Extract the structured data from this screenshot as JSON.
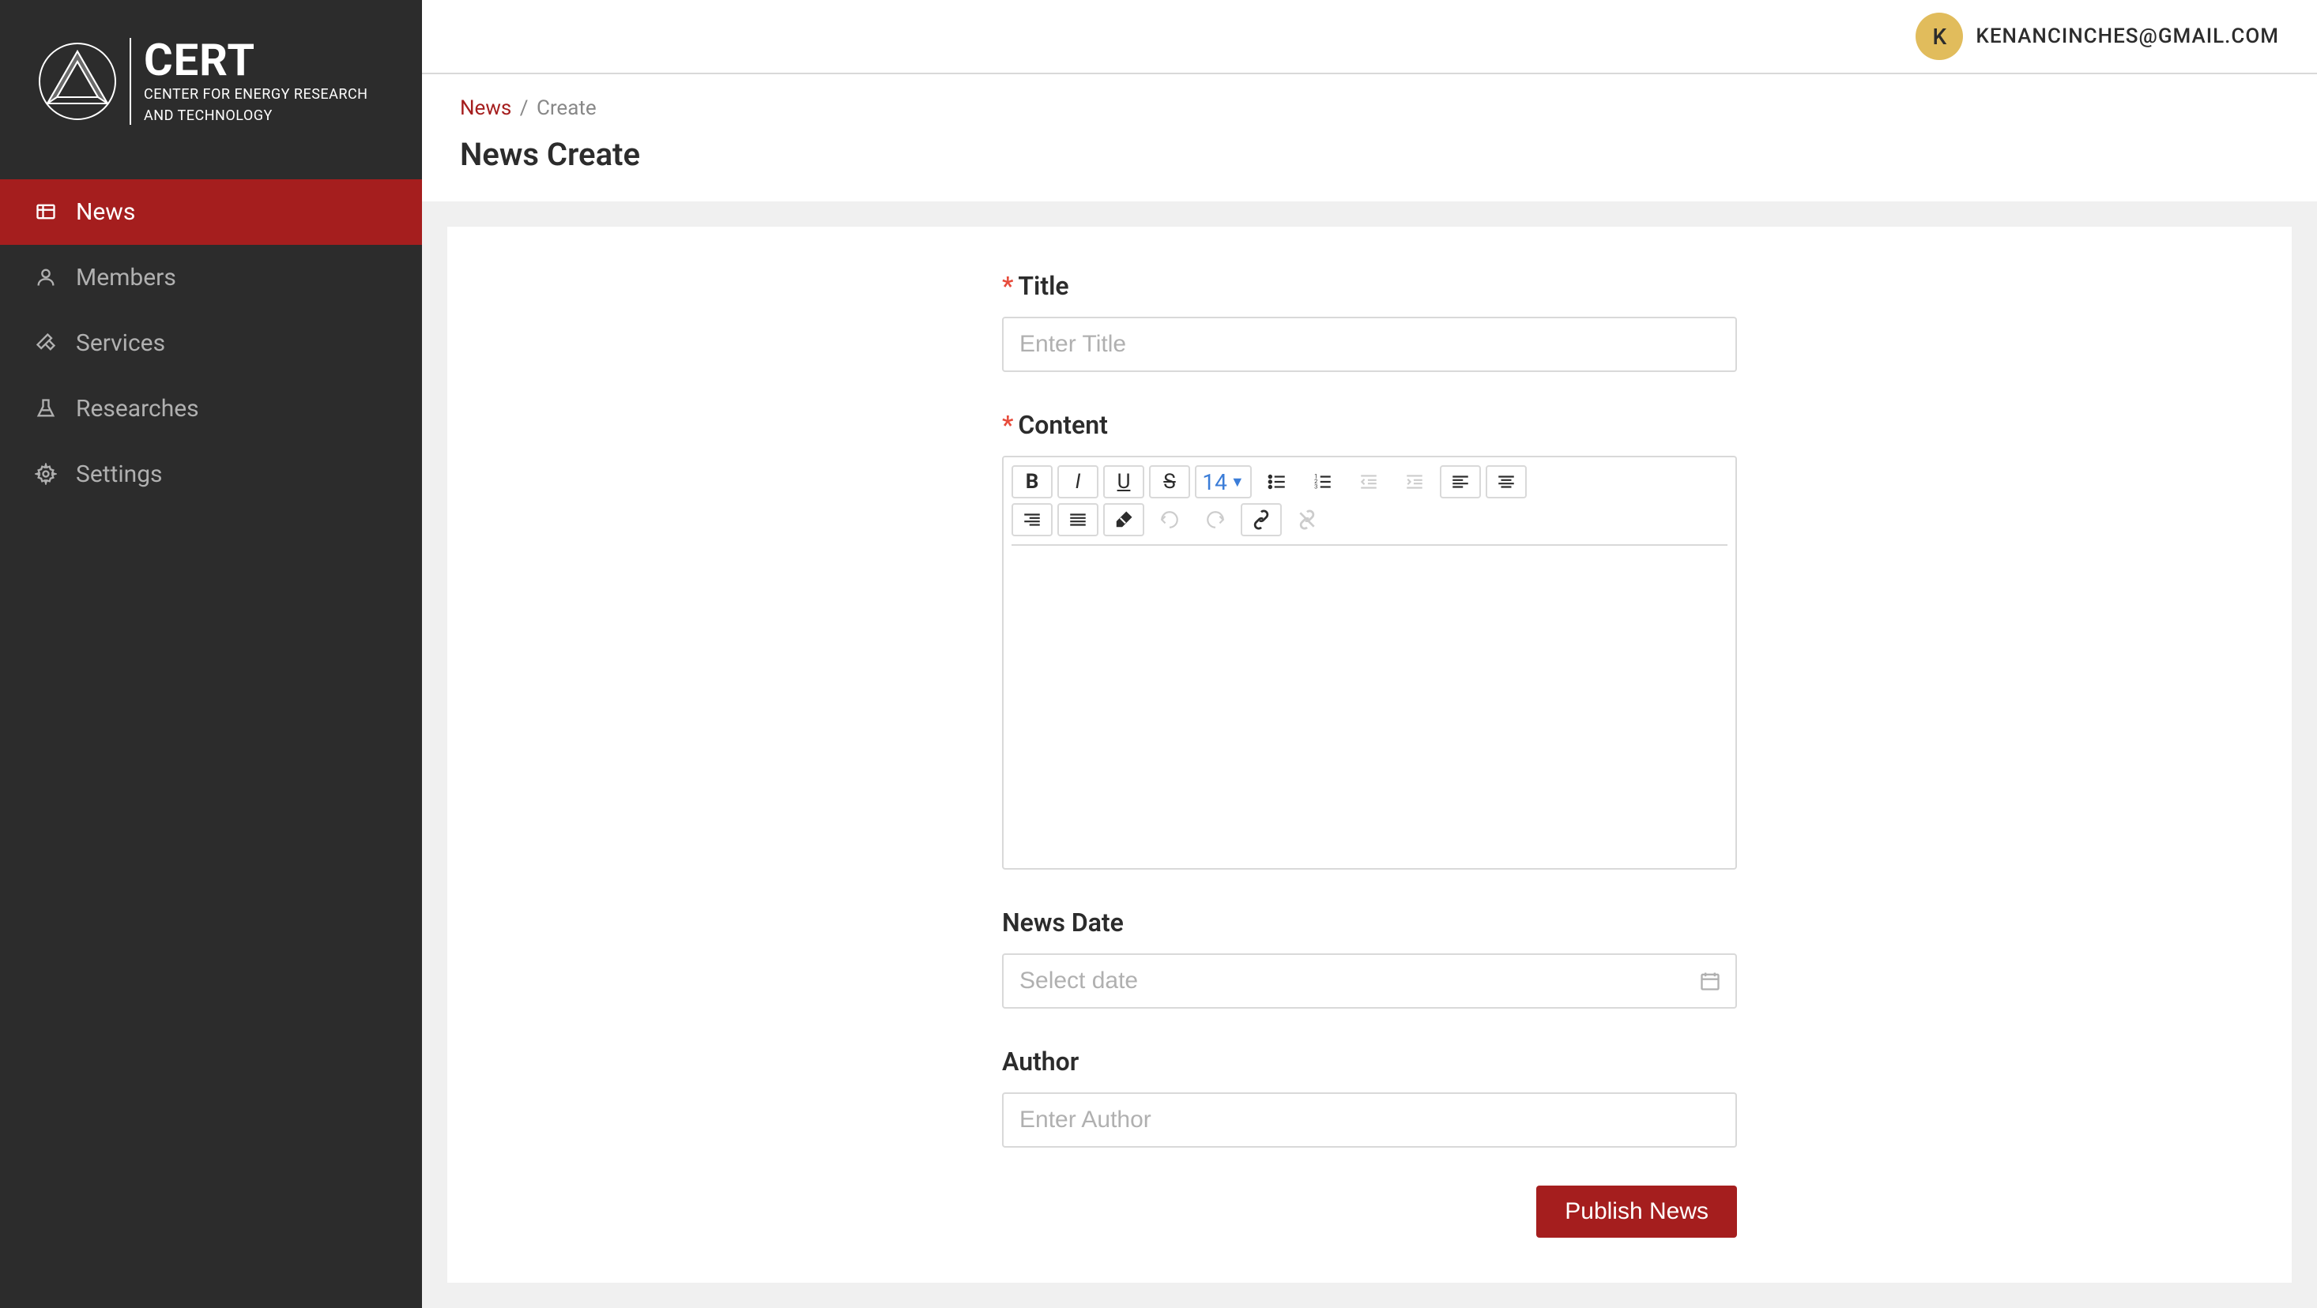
{
  "logo": {
    "title": "CERT",
    "subtitle_line1": "CENTER FOR ENERGY RESEARCH",
    "subtitle_line2": "AND TECHNOLOGY"
  },
  "sidebar": {
    "items": [
      {
        "label": "News",
        "icon": "news"
      },
      {
        "label": "Members",
        "icon": "members"
      },
      {
        "label": "Services",
        "icon": "services"
      },
      {
        "label": "Researches",
        "icon": "researches"
      },
      {
        "label": "Settings",
        "icon": "settings"
      }
    ]
  },
  "user": {
    "avatar_letter": "K",
    "email": "KENANCINCHES@GMAIL.COM"
  },
  "breadcrumb": {
    "link": "News",
    "separator": "/",
    "current": "Create"
  },
  "page": {
    "title": "News Create"
  },
  "form": {
    "title": {
      "label": "Title",
      "placeholder": "Enter Title",
      "required": "*"
    },
    "content": {
      "label": "Content",
      "required": "*"
    },
    "font_size": "14",
    "news_date": {
      "label": "News Date",
      "placeholder": "Select date"
    },
    "author": {
      "label": "Author",
      "placeholder": "Enter Author"
    },
    "submit": "Publish News"
  }
}
